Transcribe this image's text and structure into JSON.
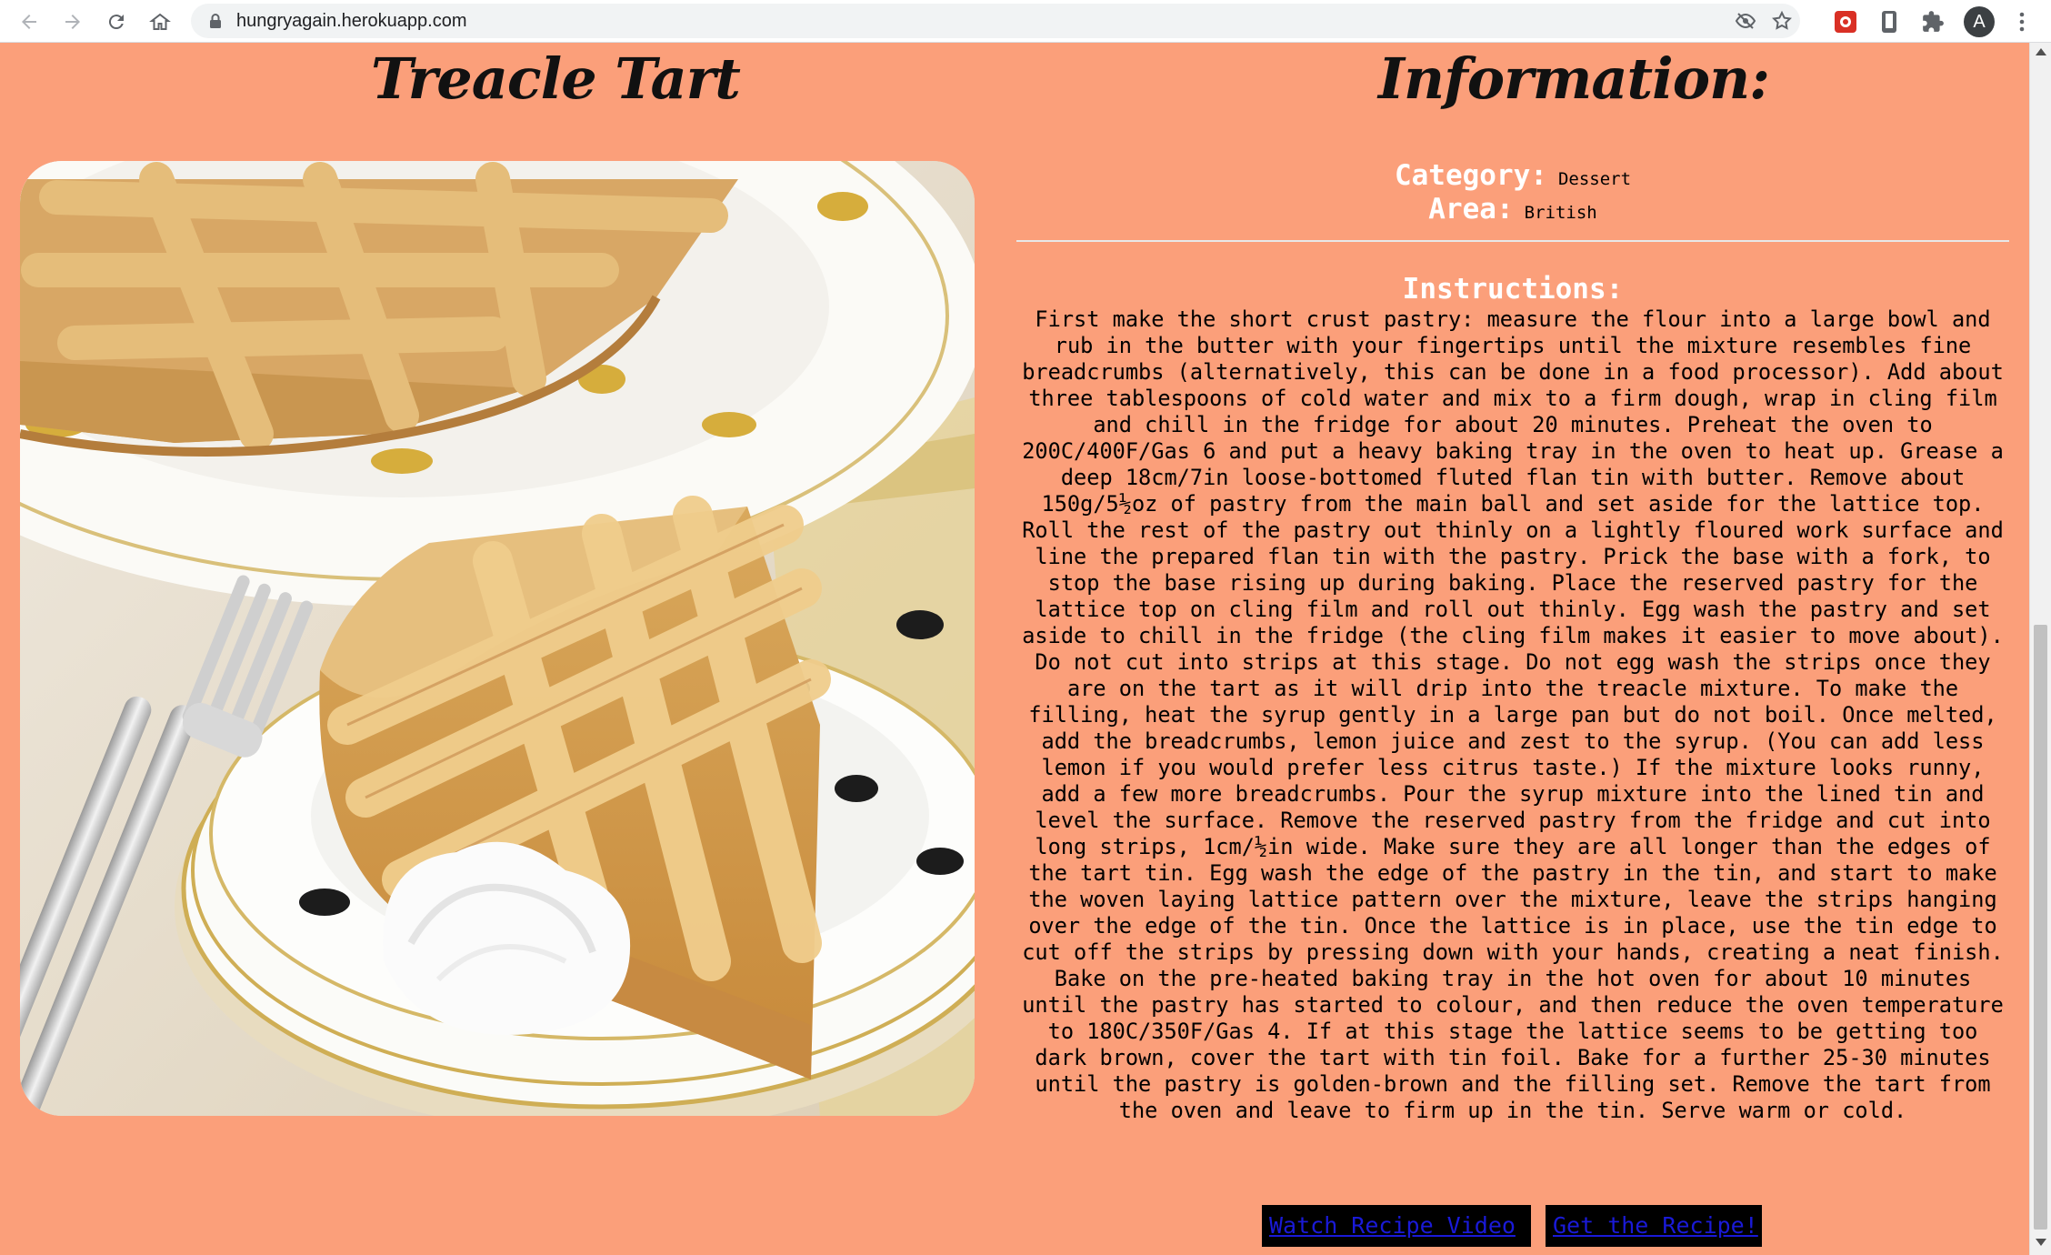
{
  "browser": {
    "url": "hungryagain.herokuapp.com",
    "avatar_letter": "A",
    "icons": [
      "back-icon",
      "forward-icon",
      "reload-icon",
      "home-icon",
      "lock-icon",
      "eye-slash-icon",
      "star-icon",
      "extension-red-icon",
      "extension-phone-icon",
      "puzzle-icon",
      "menu-dots-icon"
    ]
  },
  "recipe": {
    "title": "Treacle Tart",
    "image_alt": "treacle-tart-photo"
  },
  "info": {
    "title": "Information:",
    "category_label": "Category:",
    "category_value": "Dessert",
    "area_label": "Area:",
    "area_value": "British",
    "instructions_label": "Instructions:",
    "instructions_text": "First make the short crust pastry: measure the flour into a large bowl and rub in the butter with your fingertips until the mixture resembles fine breadcrumbs (alternatively, this can be done in a food processor). Add about three tablespoons of cold water and mix to a firm dough, wrap in cling film and chill in the fridge for about 20 minutes. Preheat the oven to 200C/400F/Gas 6 and put a heavy baking tray in the oven to heat up. Grease a deep 18cm/7in loose-bottomed fluted flan tin with butter. Remove about 150g/5½oz of pastry from the main ball and set aside for the lattice top. Roll the rest of the pastry out thinly on a lightly floured work surface and line the prepared flan tin with the pastry. Prick the base with a fork, to stop the base rising up during baking. Place the reserved pastry for the lattice top on cling film and roll out thinly. Egg wash the pastry and set aside to chill in the fridge (the cling film makes it easier to move about). Do not cut into strips at this stage. Do not egg wash the strips once they are on the tart as it will drip into the treacle mixture. To make the filling, heat the syrup gently in a large pan but do not boil. Once melted, add the breadcrumbs, lemon juice and zest to the syrup. (You can add less lemon if you would prefer less citrus taste.) If the mixture looks runny, add a few more breadcrumbs. Pour the syrup mixture into the lined tin and level the surface. Remove the reserved pastry from the fridge and cut into long strips, 1cm/½in wide. Make sure they are all longer than the edges of the tart tin. Egg wash the edge of the pastry in the tin, and start to make the woven laying lattice pattern over the mixture, leave the strips hanging over the edge of the tin. Once the lattice is in place, use the tin edge to cut off the strips by pressing down with your hands, creating a neat finish. Bake on the pre-heated baking tray in the hot oven for about 10 minutes until the pastry has started to colour, and then reduce the oven temperature to 180C/350F/Gas 4. If at this stage the lattice seems to be getting too dark brown, cover the tart with tin foil. Bake for a further 25-30 minutes until the pastry is golden-brown and the filling set. Remove the tart from the oven and leave to firm up in the tin. Serve warm or cold."
  },
  "buttons": {
    "video_label": "Watch Recipe Video ",
    "recipe_label": "Get the Recipe!"
  },
  "colors": {
    "page_background": "#fb9f7a",
    "button_background": "#000000",
    "link_color": "#1a1ad8",
    "label_color": "#ffffff"
  }
}
